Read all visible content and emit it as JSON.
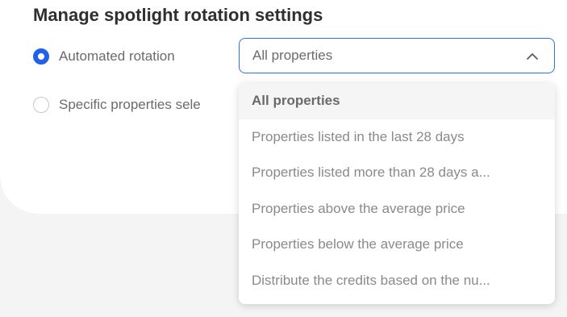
{
  "title": "Manage spotlight rotation settings",
  "radios": [
    {
      "label": "Automated rotation",
      "checked": true
    },
    {
      "label": "Specific properties sele",
      "checked": false
    }
  ],
  "select": {
    "value": "All properties",
    "expanded": true,
    "options": [
      {
        "label": "All properties",
        "selected": true
      },
      {
        "label": "Properties listed in the last 28 days",
        "selected": false
      },
      {
        "label": "Properties listed more than 28 days a...",
        "selected": false
      },
      {
        "label": "Properties above the average price",
        "selected": false
      },
      {
        "label": "Properties below the average price",
        "selected": false
      },
      {
        "label": "Distribute the credits based on the nu...",
        "selected": false
      }
    ]
  },
  "icons": {
    "select_toggle": "chevron-up-icon"
  },
  "colors": {
    "accent": "#2160e8",
    "select_border": "#2f6ef0",
    "page_background": "#f4f4f4",
    "card_background": "#ffffff"
  }
}
